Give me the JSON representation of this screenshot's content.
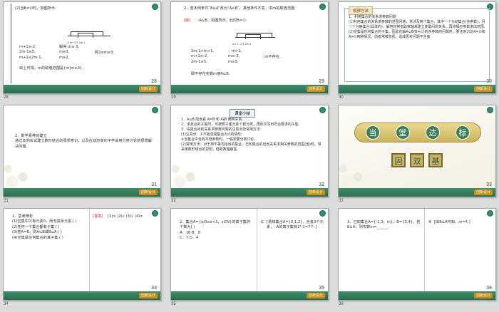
{
  "thumbnails": [
    {
      "page": "28",
      "bottom_left": "28"
    },
    {
      "page": "29",
      "bottom_left": "29"
    },
    {
      "page": "30",
      "bottom_left": "30"
    },
    {
      "page": "31",
      "bottom_left": "31"
    },
    {
      "page": "32",
      "bottom_left": "32"
    },
    {
      "page": "33",
      "bottom_left": "33"
    },
    {
      "page": "34",
      "bottom_left": "34"
    },
    {
      "page": "35",
      "bottom_left": "35"
    },
    {
      "page": "36",
      "bottom_left": "36"
    }
  ],
  "badge": "创新设计",
  "s28": {
    "line1": "(2)当B≠∅时，如图所示.",
    "nl_label": "-2  m+1   5  2m-1",
    "sys1": "m+1≥-2,\n2m-1≤5,\nm+1≤2m-1,",
    "sys2": "解得 m≥-3,\nm≤3,\nm≥2,",
    "res": "即2≤m≤3.",
    "line3": "综上可得，m的取值范围是{m|m≤3}."
  },
  "s29": {
    "line1": "2．若本例条件“B⊆A”改为“A⊆B”，其他条件不变，求m的取值范围.",
    "jie": "[解]",
    "line2": "∵A⊆B，如图所示，此时B≠∅.",
    "nl_label": "m+1 -2   5  2m-1",
    "sys1": "2m-1>m+1,\nm+1≤-2,\n2m-1≥5,",
    "sys2": "∴ m>2,\nm≤-3,\nm≥3,",
    "res": "∴m不存在.",
    "line3": "即不存在实数m使A⊆B."
  },
  "s30": {
    "title": "规律方法",
    "body": "1．利用集合的关系求参数问题\n(1)利用集合的关系求参数的范围问题，常涉及两个集合，其中一个为动集合(含参数)，另一个为静集合(具体的)，解答时常借助数轴来建立变量间的关系，再将相应参数求出范围.\n(2)空集是任何集合的子集，因此在解A⊆B(B≠∅)的含参数的问题时，要注意讨论A=∅和A≠∅两种情况，前者常被忽视，造成思考问题不全面."
  },
  "s31": {
    "body": "2．数学素养的建立\n通过本例会试建立数形结合的思想意识，以及在动态变化中学会用分类讨论的思想解决问题."
  },
  "s32": {
    "title": "课堂小结",
    "body": "1．A⊆B 隐含着 A=B 和 A⫋B 两种关系.\n2．求具合的子集时，可按照子集元素个数分类，再依次写出符合要求的子集.\n3．由集合间的关系求参数问题的注意点及常用方法\n(1)注意点：①不能忽视集合为∅的情形;\n②当集合中含有字母参数时，一般需要分类讨论.\n(2)常用方法：对于用不等式给出的集合，已知集合的包含关系求相关参数的范围(值)时，常采用数形结合的思想，借助数轴解答."
  },
  "s33": {
    "banner": [
      "当",
      "堂",
      "达",
      "标"
    ],
    "seal": [
      "固",
      "双",
      "基"
    ]
  },
  "s34": {
    "left": "1．思考辨析\n(1)空集中只有元素0，而无其余元素.(    )\n(2)任何一个集合都有子集.(    )\n(3)若A=B，则A⊆B或B⊆A.(    )\n(4)空集是任何集合的真子集.(    )",
    "answer_label": "[答案]",
    "answer": "(1)×  (2)√  (3)√  (4)×"
  },
  "s35": {
    "left": "2．集合A={x|0≤x<3，x∈N}的真子集的个数为(    )\nA．16          B．8\nC．7           D．4",
    "answer_letter": "C",
    "answer": "[易知集合A={0,1,2}，含有3个元素，∴A的真子集有2³-1=7个.]"
  },
  "s36": {
    "left": "3．已知集合A={-1,3，m}，B={3,4}，若B⊆A，则实数m=______.",
    "answer_num": "4",
    "answer": "[由B⊆A可知，m=4.]"
  }
}
